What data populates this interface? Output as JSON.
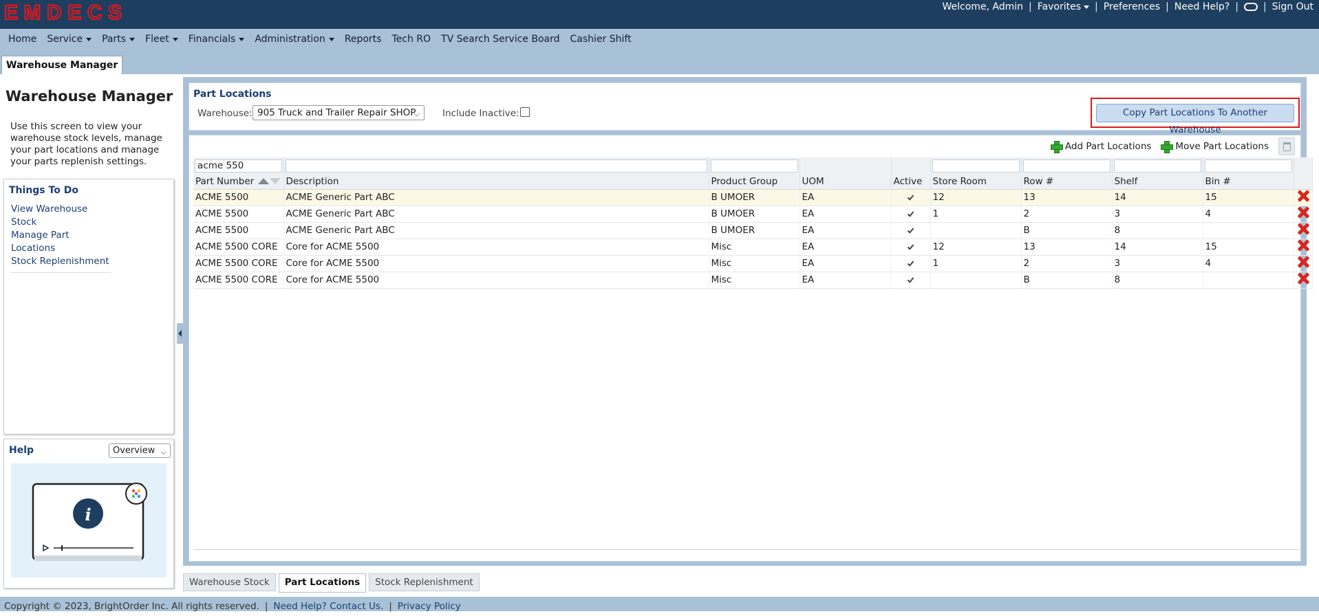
{
  "app": {
    "logo_text": "EMDECS"
  },
  "userbar": {
    "welcome": "Welcome, Admin",
    "favorites": "Favorites",
    "preferences": "Preferences",
    "need_help": "Need Help?",
    "sign_out": "Sign Out"
  },
  "menu": [
    "Home",
    "Service",
    "Parts",
    "Fleet",
    "Financials",
    "Administration",
    "Reports",
    "Tech RO",
    "TV Search Service Board",
    "Cashier Shift"
  ],
  "page_tab": "Warehouse Manager",
  "left": {
    "title": "Warehouse Manager",
    "description": "Use this screen to view your warehouse stock levels, manage your part locations and manage your parts replenish settings.",
    "todo_title": "Things To Do",
    "todo_items": [
      "View Warehouse Stock",
      "Manage Part Locations",
      "Stock Replenishment"
    ],
    "help_title": "Help",
    "help_select": "Overview"
  },
  "filter": {
    "title": "Part Locations",
    "warehouse_label": "Warehouse:",
    "warehouse_value": "905 Truck and Trailer Repair SHOP",
    "include_inactive_label": "Include Inactive:",
    "copy_button": "Copy Part Locations To Another Warehouse"
  },
  "grid": {
    "add_label": "Add Part Locations",
    "move_label": "Move Part Locations",
    "filter_part": "acme 550",
    "columns": [
      "Part Number",
      "Description",
      "Product Group",
      "UOM",
      "Active",
      "Store Room",
      "Row #",
      "Shelf",
      "Bin #"
    ],
    "rows": [
      {
        "part": "ACME 5500",
        "desc": "ACME Generic Part ABC",
        "group": "B UMOER",
        "uom": "EA",
        "store": "12",
        "row": "13",
        "shelf": "14",
        "bin": "15"
      },
      {
        "part": "ACME 5500",
        "desc": "ACME Generic Part ABC",
        "group": "B UMOER",
        "uom": "EA",
        "store": "1",
        "row": "2",
        "shelf": "3",
        "bin": "4"
      },
      {
        "part": "ACME 5500",
        "desc": "ACME Generic Part ABC",
        "group": "B UMOER",
        "uom": "EA",
        "store": "",
        "row": "B",
        "shelf": "8",
        "bin": ""
      },
      {
        "part": "ACME 5500 CORE",
        "desc": "Core for ACME 5500",
        "group": "Misc",
        "uom": "EA",
        "store": "12",
        "row": "13",
        "shelf": "14",
        "bin": "15"
      },
      {
        "part": "ACME 5500 CORE",
        "desc": "Core for ACME 5500",
        "group": "Misc",
        "uom": "EA",
        "store": "1",
        "row": "2",
        "shelf": "3",
        "bin": "4"
      },
      {
        "part": "ACME 5500 CORE",
        "desc": "Core for ACME 5500",
        "group": "Misc",
        "uom": "EA",
        "store": "",
        "row": "B",
        "shelf": "8",
        "bin": ""
      }
    ]
  },
  "bottom_tabs": [
    "Warehouse Stock",
    "Part Locations",
    "Stock Replenishment"
  ],
  "footer": {
    "copyright": "Copyright © 2023, BrightOrder Inc. All rights reserved.",
    "help_link": "Need Help? Contact Us.",
    "privacy": "Privacy Policy"
  },
  "colors": {
    "header": "#1d3e5f",
    "menu": "#a9c1d6",
    "accent_red": "#e01616",
    "link": "#1b3f73"
  }
}
